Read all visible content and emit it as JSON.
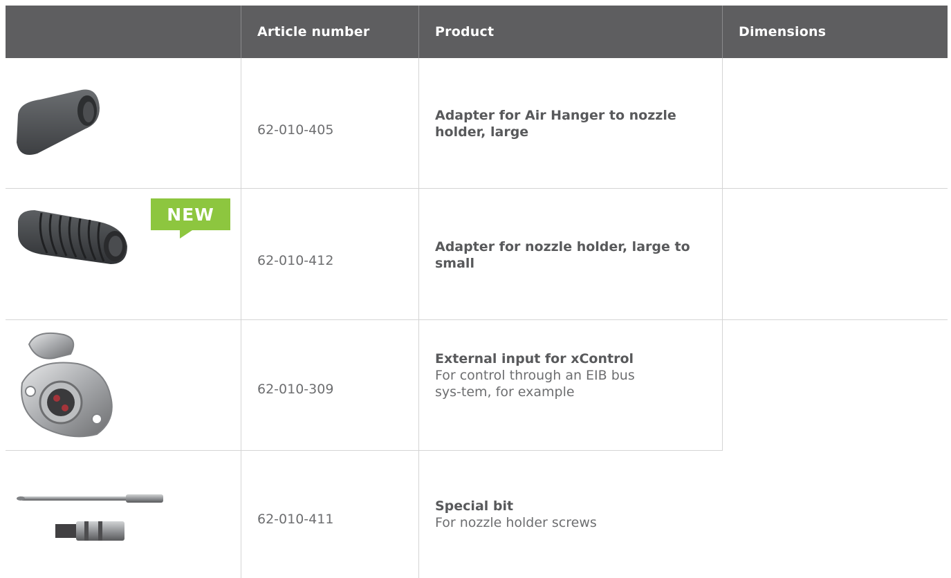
{
  "table": {
    "headers": {
      "image": "",
      "article_number": "Article number",
      "product": "Product",
      "dimensions": "Dimensions"
    },
    "rows": [
      {
        "image_icon": "rubber-adapter-image",
        "badge": "",
        "article_number": "62-010-405",
        "product_title": "Adapter for Air Hanger to nozzle holder, large",
        "product_desc": "",
        "dimensions": ""
      },
      {
        "image_icon": "ribbed-adapter-image",
        "badge": "NEW",
        "article_number": "62-010-412",
        "product_title": "Adapter for nozzle holder, large to small",
        "product_desc": "",
        "dimensions": ""
      },
      {
        "image_icon": "connector-socket-image",
        "badge": "",
        "article_number": "62-010-309",
        "product_title": "External input for xControl",
        "product_desc": "For control through an EIB bus sys-tem, for example",
        "dimensions": ""
      },
      {
        "image_icon": "special-bit-image",
        "badge": "",
        "article_number": "62-010-411",
        "product_title": "Special bit",
        "product_desc": "For nozzle holder screws",
        "dimensions": ""
      }
    ]
  },
  "colors": {
    "header_bg": "#5e5e60",
    "badge_green": "#8dc63f",
    "text": "#58595b",
    "grid": "#d4d4d4"
  }
}
